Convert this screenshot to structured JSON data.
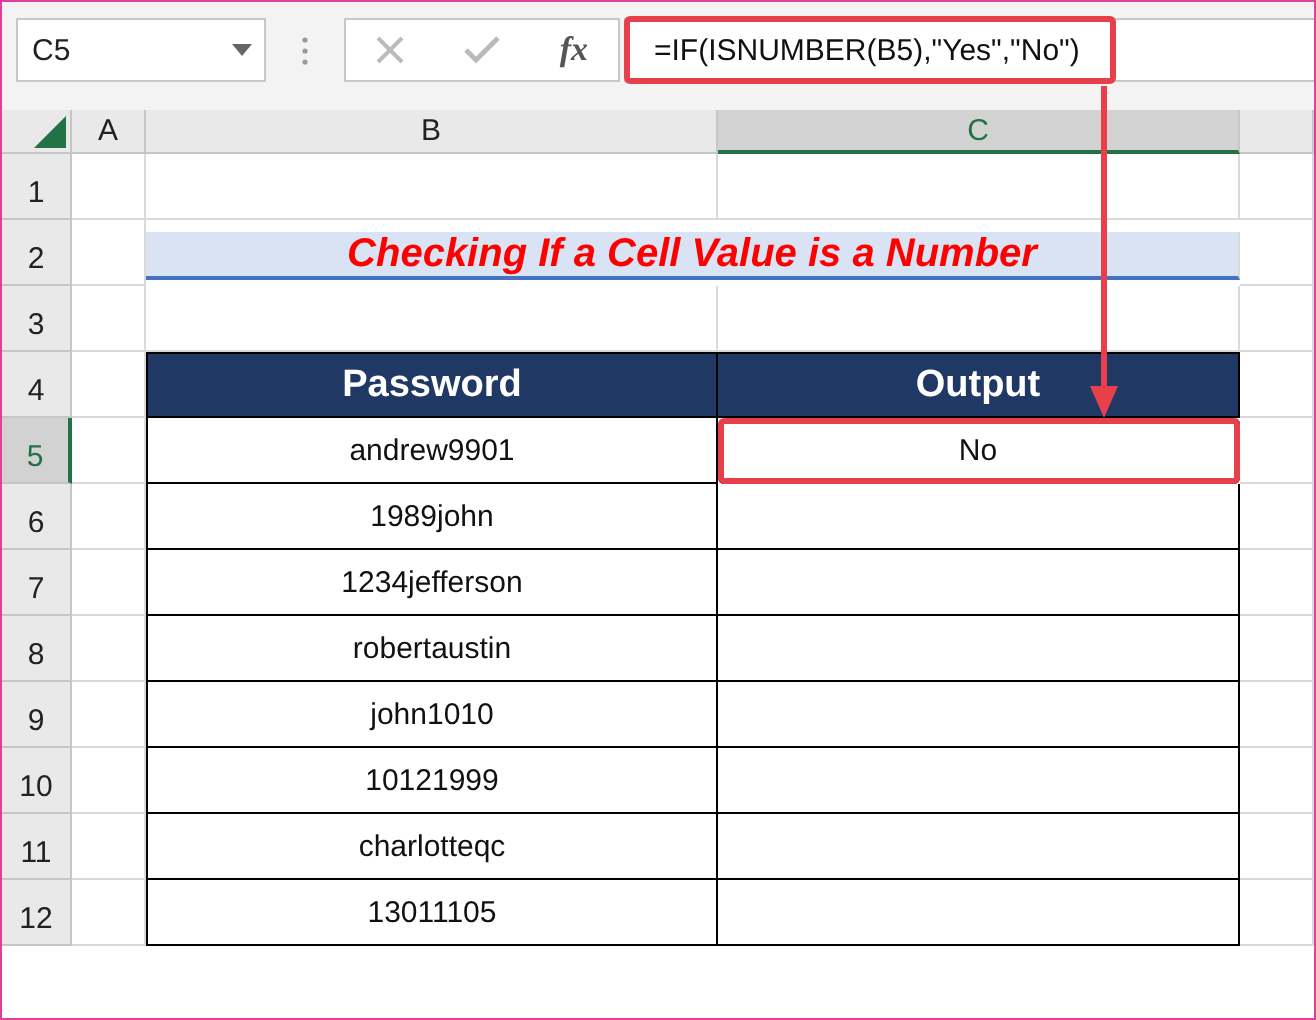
{
  "formula_bar": {
    "name_box": "C5",
    "function_label": "fx",
    "formula": "=IF(ISNUMBER(B5),\"Yes\",\"No\")",
    "highlighted": true
  },
  "columns": [
    {
      "label": "A",
      "selected": false
    },
    {
      "label": "B",
      "selected": false
    },
    {
      "label": "C",
      "selected": true
    }
  ],
  "row_headers": [
    {
      "label": "1",
      "selected": false
    },
    {
      "label": "2",
      "selected": false
    },
    {
      "label": "3",
      "selected": false
    },
    {
      "label": "4",
      "selected": false
    },
    {
      "label": "5",
      "selected": true
    },
    {
      "label": "6",
      "selected": false
    },
    {
      "label": "7",
      "selected": false
    },
    {
      "label": "8",
      "selected": false
    },
    {
      "label": "9",
      "selected": false
    },
    {
      "label": "10",
      "selected": false
    },
    {
      "label": "11",
      "selected": false
    },
    {
      "label": "12",
      "selected": false
    }
  ],
  "title": "Checking If a Cell Value is a Number",
  "table": {
    "headers": [
      "Password",
      "Output"
    ],
    "rows": [
      {
        "password": "andrew9901",
        "output": "No",
        "highlighted": true
      },
      {
        "password": "1989john",
        "highlighted": false
      },
      {
        "password": "1234jefferson",
        "highlighted": false
      },
      {
        "password": "robertaustin",
        "highlighted": false
      },
      {
        "password": "john1010",
        "highlighted": false
      },
      {
        "password": "10121999",
        "highlighted": false
      },
      {
        "password": "charlotteqc",
        "highlighted": false
      },
      {
        "password": "13011105",
        "highlighted": false
      }
    ]
  }
}
